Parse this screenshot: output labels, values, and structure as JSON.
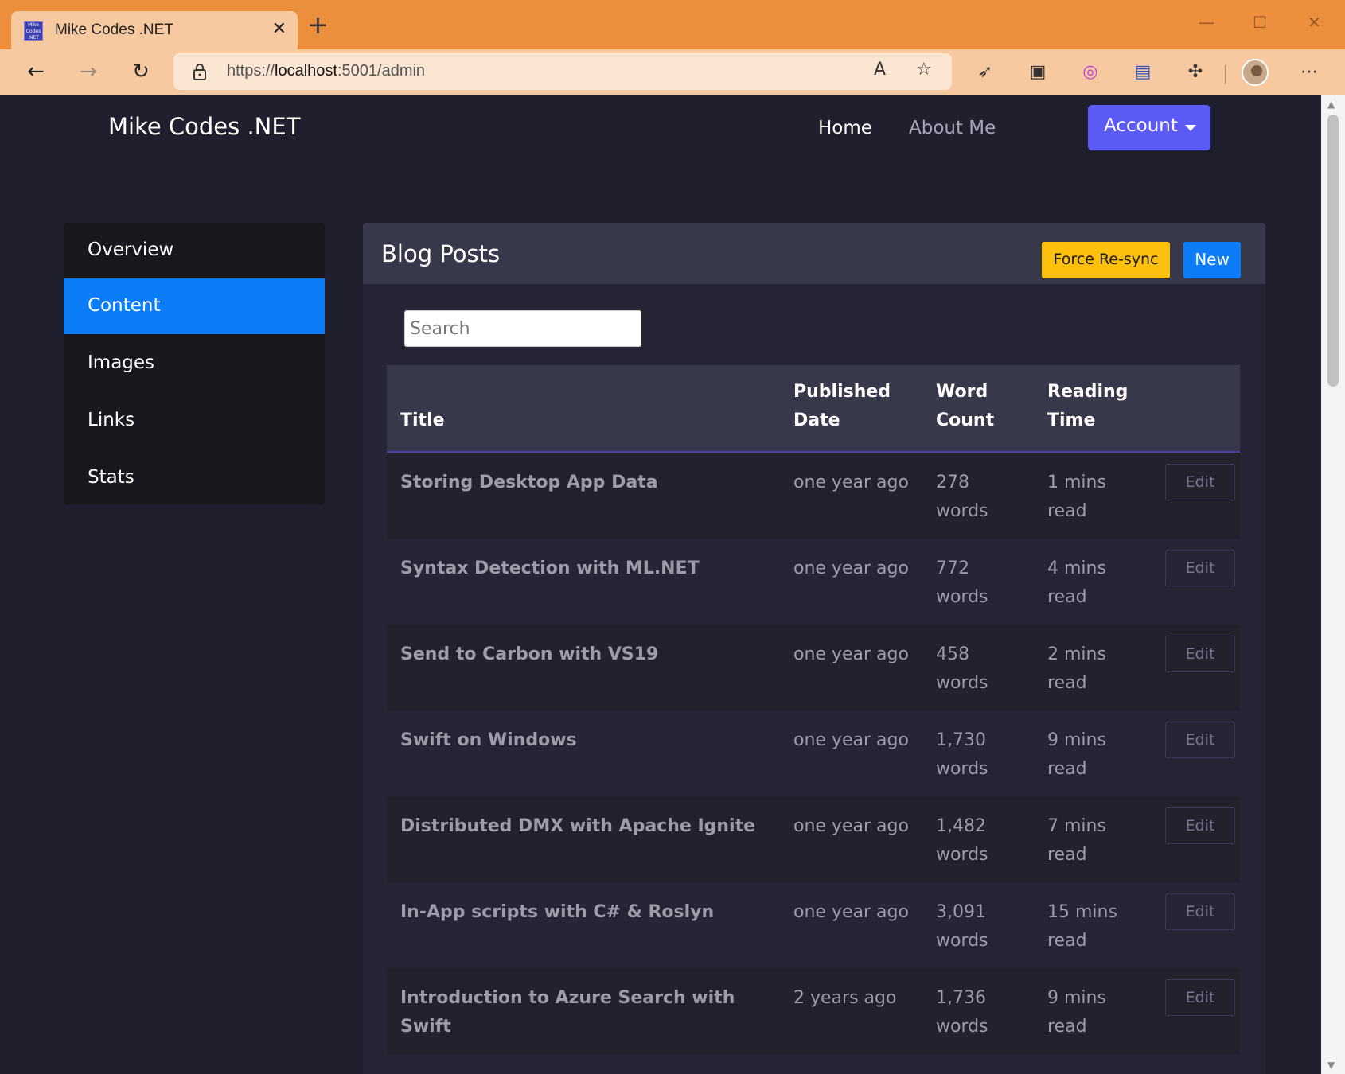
{
  "browser": {
    "tab_title": "Mike Codes .NET",
    "tab_favicon_text": "Mike Codes .NET",
    "tab_close": "✕",
    "new_tab": "+",
    "url_scheme": "https://",
    "url_host": "localhost",
    "url_rest": ":5001/admin",
    "controls": {
      "minimize": "—",
      "maximize": "☐",
      "close": "✕"
    }
  },
  "navbar": {
    "brand": "Mike Codes .NET",
    "links": [
      "Home",
      "About Me"
    ],
    "account_label": "Account"
  },
  "sidebar": {
    "items": [
      {
        "label": "Overview",
        "active": false
      },
      {
        "label": "Content",
        "active": true
      },
      {
        "label": "Images",
        "active": false
      },
      {
        "label": "Links",
        "active": false
      },
      {
        "label": "Stats",
        "active": false
      }
    ]
  },
  "card": {
    "title": "Blog Posts",
    "resync_label": "Force Re-sync",
    "new_label": "New",
    "search_placeholder": "Search"
  },
  "table": {
    "headers": {
      "title": "Title",
      "published_date": "Published Date",
      "word_count": "Word Count",
      "reading_time": "Reading Time"
    },
    "edit_label": "Edit",
    "rows": [
      {
        "title": "Storing Desktop App Data",
        "date": "one year ago",
        "words": "278 words",
        "reading": "1 mins read"
      },
      {
        "title": "Syntax Detection with ML.NET",
        "date": "one year ago",
        "words": "772 words",
        "reading": "4 mins read"
      },
      {
        "title": "Send to Carbon with VS19",
        "date": "one year ago",
        "words": "458 words",
        "reading": "2 mins read"
      },
      {
        "title": "Swift on Windows",
        "date": "one year ago",
        "words": "1,730 words",
        "reading": "9 mins read"
      },
      {
        "title": "Distributed DMX with Apache Ignite",
        "date": "one year ago",
        "words": "1,482 words",
        "reading": "7 mins read"
      },
      {
        "title": "In-App scripts with C# & Roslyn",
        "date": "one year ago",
        "words": "3,091 words",
        "reading": "15 mins read"
      },
      {
        "title": "Introduction to Azure Search with Swift",
        "date": "2 years ago",
        "words": "1,736 words",
        "reading": "9 mins read"
      }
    ]
  },
  "colors": {
    "titlebar": "#ec8f3c",
    "page_bg": "#1f1f2e",
    "primary": "#0d7df7",
    "account": "#5d5bf5",
    "warning": "#fdc00c"
  }
}
